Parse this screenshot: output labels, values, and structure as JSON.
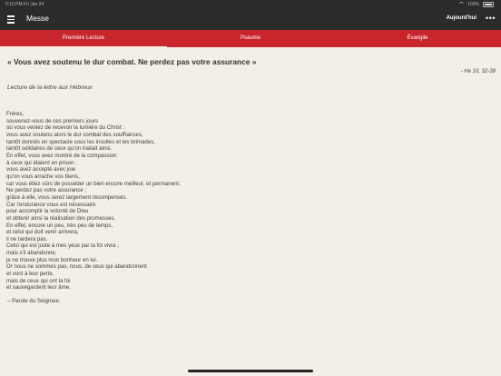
{
  "status_bar": {
    "time_date": "6:10 PM   Fri Jan 24",
    "battery": "100%"
  },
  "nav": {
    "title": "Messe",
    "today_label": "Aujourd'hui",
    "more_label": "•••"
  },
  "tabs": [
    {
      "label": "Première Lecture",
      "active": true
    },
    {
      "label": "Psaume",
      "active": false
    },
    {
      "label": "Évangile",
      "active": false
    }
  ],
  "reading": {
    "title": "« Vous avez soutenu le dur combat. Ne perdez pas votre assurance »",
    "reference": "- He 10, 32-39",
    "intro": "Lecture de la lettre aux Hébreux",
    "lines": [
      "Frères,",
      "souvenez-vous de ces premiers jours",
      "où vous veniez de recevoir la lumière du Christ :",
      "vous avez soutenu alors le dur combat des souffrances,",
      "tantôt donnés en spectacle sous les insultes et les brimades,",
      "tantôt solidaires de ceux qu'on traitait ainsi.",
      "En effet, vous avez montré de la compassion",
      "à ceux qui étaient en prison ;",
      "vous avez accepté avec joie",
      "qu'on vous arrache vos biens,",
      "car vous étiez sûrs de posséder un bien encore meilleur, et permanent.",
      "Ne perdez pas votre assurance ;",
      "grâce à elle, vous serez largement récompensés.",
      "Car l'endurance vous est nécessaire",
      "pour accomplir la volonté de Dieu",
      "et obtenir ainsi la réalisation des promesses.",
      "En effet, encore un peu, très peu de temps,",
      "et celui qui doit venir arrivera,",
      "il ne tardera pas.",
      "Celui qui est juste à mes yeux par la foi vivra ;",
      "mais s'il abandonne,",
      "je ne trouve plus mon bonheur en lui.",
      "Or nous ne sommes pas, nous, de ceux qui abandonnent",
      "et vont à leur perte,",
      "mais de ceux qui ont la foi",
      "et sauvegardent leur âme."
    ],
    "closing": "– Parole du Seigneur."
  },
  "colors": {
    "header_bg": "#2b2b2b",
    "tab_bar_bg": "#c9252c",
    "page_bg": "#f3efe6"
  }
}
